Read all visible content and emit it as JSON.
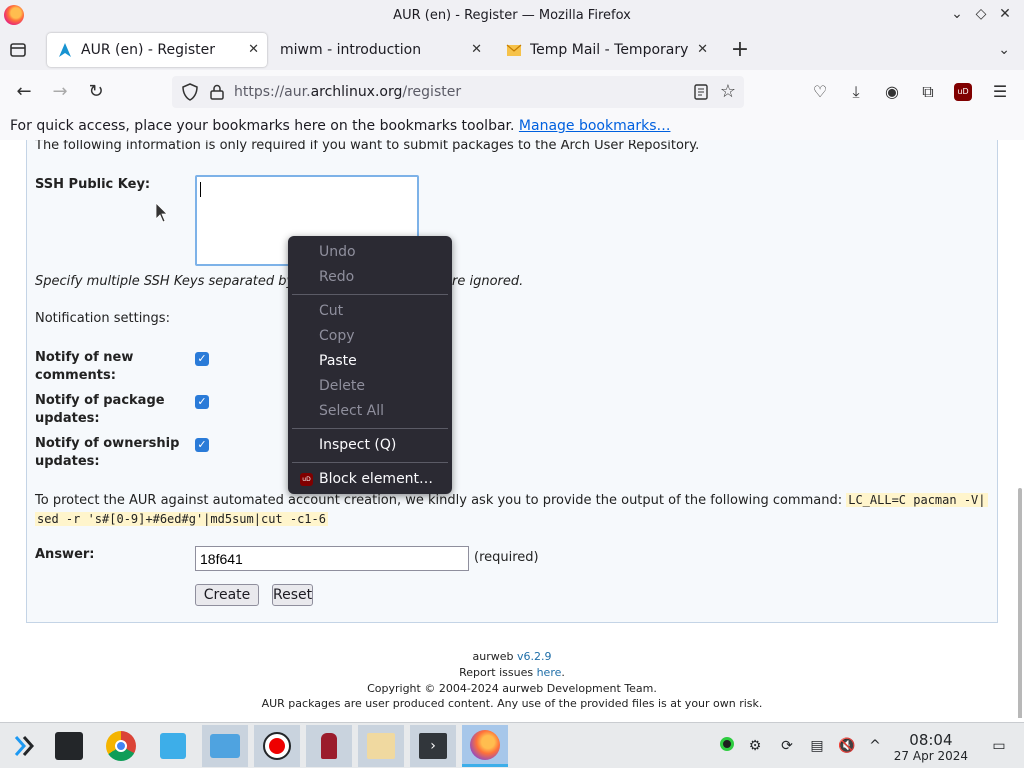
{
  "window": {
    "title": "AUR (en) - Register — Mozilla Firefox"
  },
  "tabs": [
    {
      "label": "AUR (en) - Register",
      "active": true,
      "close": "✕"
    },
    {
      "label": "miwm - introduction",
      "active": false,
      "close": "✕"
    },
    {
      "label": "Temp Mail - Temporary D",
      "active": false,
      "close": "✕"
    }
  ],
  "newtab": "+",
  "navbar": {
    "url_prefix": "https://aur.",
    "url_domain": "archlinux.org",
    "url_suffix": "/register"
  },
  "bookmarks_bar": {
    "text": "For quick access, place your bookmarks here on the bookmarks toolbar.",
    "link": "Manage bookmarks…"
  },
  "form": {
    "intro": "The following information is only required if you want to submit packages to the Arch User Repository.",
    "ssh_label": "SSH Public Key:",
    "ssh_value": "",
    "ssh_hint_left": "Specify multiple SSH Keys separated by",
    "ssh_hint_right": "re ignored.",
    "notification_settings": "Notification settings:",
    "notify_comments_line1": "Notify of new",
    "notify_comments_line2": "comments:",
    "notify_updates_line1": "Notify of package",
    "notify_updates_line2": "updates:",
    "notify_ownership_line1": "Notify of ownership",
    "notify_ownership_line2": "updates:",
    "captcha_text": "To protect the AUR against automated account creation, we kindly ask you to provide the output of the following command:",
    "captcha_cmd_1": "LC_ALL=C pacman -V|",
    "captcha_cmd_2": "sed -r 's#[0-9]+#6ed#g'|md5sum|cut -c1-6",
    "answer_label": "Answer:",
    "answer_value": "18f641",
    "required": "(required)",
    "create": "Create",
    "reset": "Reset"
  },
  "footer": {
    "aurweb": "aurweb",
    "version": "v6.2.9",
    "report_prefix": "Report issues",
    "report_link": "here",
    "report_suffix": ".",
    "copyright": "Copyright © 2004-2024 aurweb Development Team.",
    "disclaimer": "AUR packages are user produced content. Any use of the provided files is at your own risk."
  },
  "context_menu": {
    "undo": "Undo",
    "redo": "Redo",
    "cut": "Cut",
    "copy": "Copy",
    "paste": "Paste",
    "delete": "Delete",
    "select_all": "Select All",
    "inspect": "Inspect (Q)",
    "block": "Block element…",
    "ublock_badge": "uD"
  },
  "taskbar": {
    "time": "08:04",
    "date": "27 Apr 2024"
  },
  "colors": {
    "accent": "#0060df",
    "checkbox": "#2a7bd8",
    "menu_bg": "#2b2a33"
  }
}
